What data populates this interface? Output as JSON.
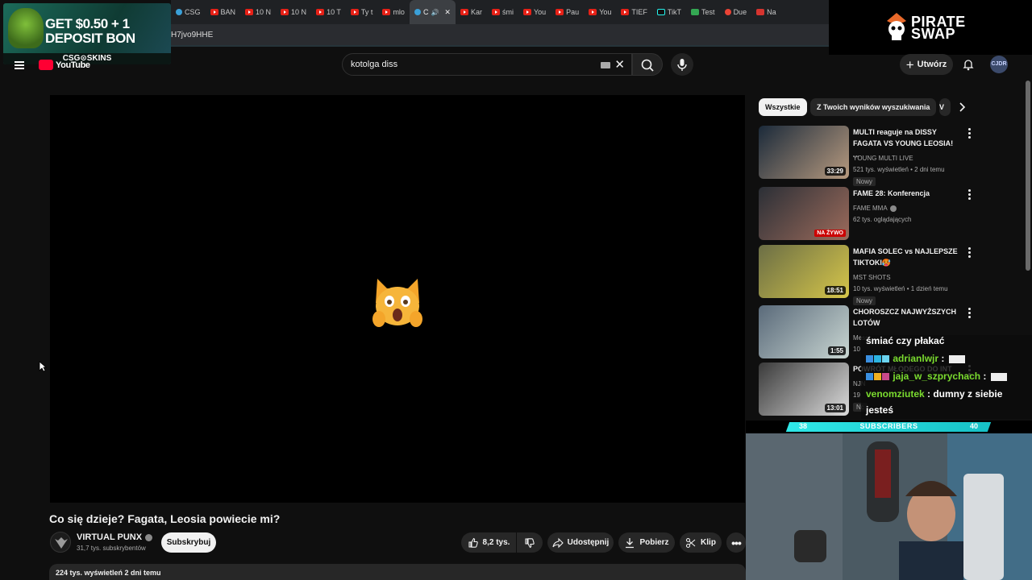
{
  "browser": {
    "tabs": [
      {
        "icon": "csgo-icon",
        "label": "CSG"
      },
      {
        "icon": "youtube-icon",
        "label": "BAN"
      },
      {
        "icon": "youtube-icon",
        "label": "10 N"
      },
      {
        "icon": "youtube-icon",
        "label": "10 N"
      },
      {
        "icon": "youtube-icon",
        "label": "10 T"
      },
      {
        "icon": "youtube-icon",
        "label": "Ty t"
      },
      {
        "icon": "youtube-icon",
        "label": "mlo"
      },
      {
        "icon": "tab-icon",
        "label": "C",
        "active": true
      },
      {
        "icon": "youtube-icon",
        "label": "Kar"
      },
      {
        "icon": "youtube-icon",
        "label": "śmi"
      },
      {
        "icon": "youtube-icon",
        "label": "You"
      },
      {
        "icon": "youtube-icon",
        "label": "Pau"
      },
      {
        "icon": "youtube-icon",
        "label": "You"
      },
      {
        "icon": "youtube-icon",
        "label": "TIEF"
      },
      {
        "icon": "tiktok-icon",
        "label": "TikT"
      },
      {
        "icon": "sheets-icon",
        "label": "Test"
      },
      {
        "icon": "maps-pin-icon",
        "label": "Due"
      },
      {
        "icon": "u-icon",
        "label": "Na"
      }
    ],
    "address_fragment": "H7jvo9HHE"
  },
  "ad_banner": {
    "line1": "GET $0.50 + 1",
    "line2": "DEPOSIT BON",
    "brand": "CSG⊙SKINS"
  },
  "sponsor_logo": {
    "line1": "PIRATE",
    "line2": "SWAP"
  },
  "header": {
    "logo_text": "YouTube",
    "search_value": "kotolga diss",
    "create_label": "Utwórz",
    "avatar_text": "CJDR"
  },
  "video": {
    "title": "Co się dzieje? Fagata, Leosia powiecie mi?",
    "channel_name": "VIRTUAL PUNX",
    "channel_subs": "31,7 tys. subskrybentów",
    "subscribe_label": "Subskrybuj",
    "likes": "8,2 tys.",
    "share_label": "Udostępnij",
    "download_label": "Pobierz",
    "clip_label": "Klip",
    "views_date": "224 tys. wyświetleń  2 dni temu"
  },
  "chips": [
    "Wszystkie",
    "Z Twoich wyników wyszukiwania",
    "V"
  ],
  "related": [
    {
      "title": "MULTI reaguje na DISSY FAGATA VS YOUNG LEOSIA! ...",
      "channel": "YOUNG MULTI LIVE",
      "verified": false,
      "stats": "521 tys. wyświetleń • 2 dni temu",
      "badge": "Nowy",
      "duration": "33:29",
      "thumb_colors": [
        "#1b2a3a",
        "#b79a7f"
      ]
    },
    {
      "title": "FAME 28: Konferencja",
      "channel": "FAME MMA",
      "verified": true,
      "stats": "62 tys. oglądających",
      "badge": "",
      "duration": "",
      "live_label": "NA ŻYWO",
      "thumb_colors": [
        "#2b2f36",
        "#9c6b5b"
      ]
    },
    {
      "title": "MAFIA SOLEC vs NAJLEPSZE TIKTOKI🥵",
      "channel": "MST SHOTS",
      "verified": false,
      "stats": "10 tys. wyświetleń • 1 dzień temu",
      "badge": "Nowy",
      "duration": "18:51",
      "thumb_colors": [
        "#6b6e45",
        "#d6c64a"
      ]
    },
    {
      "title": "CHOROSZCZ NAJWYŻSZYCH LOTÓW",
      "channel": "Messi",
      "verified": false,
      "stats": "10",
      "badge": "",
      "duration": "1:55",
      "thumb_colors": [
        "#5a6a7a",
        "#c9d6d2"
      ]
    },
    {
      "title": "POWRÓT MŁODEGO DO INT",
      "channel": "NJN",
      "verified": false,
      "stats": "19",
      "badge": "Nc",
      "duration": "13:01",
      "thumb_colors": [
        "#3a3a3a",
        "#dcdcdc"
      ]
    }
  ],
  "chat": {
    "lines": [
      {
        "user": "",
        "message": "śmiać czy płakać"
      },
      {
        "user": "adrianlwjr",
        "message": " :"
      },
      {
        "user": "jaja_w_szprychach",
        "message": " :"
      },
      {
        "user": "venomziutek",
        "message": " : dumny z siebie"
      },
      {
        "user": "",
        "message": "jesteś"
      }
    ]
  },
  "subs_goal": {
    "label": "SUBSCRIBERS",
    "current": "38",
    "goal": "40"
  },
  "colors": {
    "accent_red": "#ff0033",
    "chat_user": "#7bdc2f",
    "subs_bar": "#2fe8e8",
    "bg": "#0f0f0f"
  }
}
